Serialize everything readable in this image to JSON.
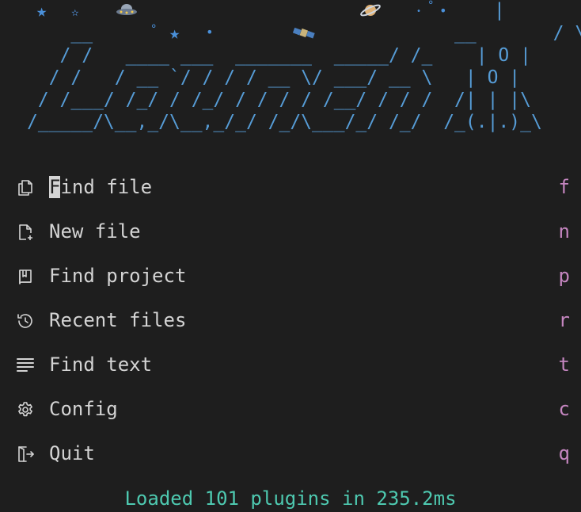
{
  "logo": {
    "ascii_lines": [
      "    __                                 __       / \\",
      "   / /   ____ ___  _______  _____/ /_    | O |",
      "  / /   / __ `/ / / / __ \\/ ___/ __ \\   | O |",
      " / /___/ /_/ / /_/ / / / / /__/ / / /  /| | |\\",
      "/_____/\\__,_/\\__,_/_/ /_/\\___/_/ /_/  /_(.|.)_\\"
    ],
    "spire": "|",
    "color": "#569cd6"
  },
  "decorations": {
    "star_glyph": "★",
    "dot_glyph": "•",
    "ring_glyph": "°",
    "ufo_name": "ufo-icon",
    "satellite_name": "satellite-icon",
    "planet_name": "ringed-planet-icon"
  },
  "menu": {
    "items": [
      {
        "icon": "files-copy-icon",
        "label_rest": "ind file",
        "label_first": "F",
        "key": "f"
      },
      {
        "icon": "new-file-icon",
        "label": "New file",
        "key": "n"
      },
      {
        "icon": "book-project-icon",
        "label": "Find project",
        "key": "p"
      },
      {
        "icon": "history-icon",
        "label": "Recent files",
        "key": "r"
      },
      {
        "icon": "text-lines-icon",
        "label": "Find text",
        "key": "t"
      },
      {
        "icon": "gear-icon",
        "label": "Config",
        "key": "c"
      },
      {
        "icon": "exit-door-icon",
        "label": "Quit",
        "key": "q"
      }
    ]
  },
  "footer": {
    "text": "Loaded 101 plugins in 235.2ms",
    "color": "#4ec9b0"
  },
  "colors": {
    "background": "#1e1e1e",
    "text": "#d4d4d4",
    "key": "#c586c0",
    "logo": "#569cd6"
  }
}
